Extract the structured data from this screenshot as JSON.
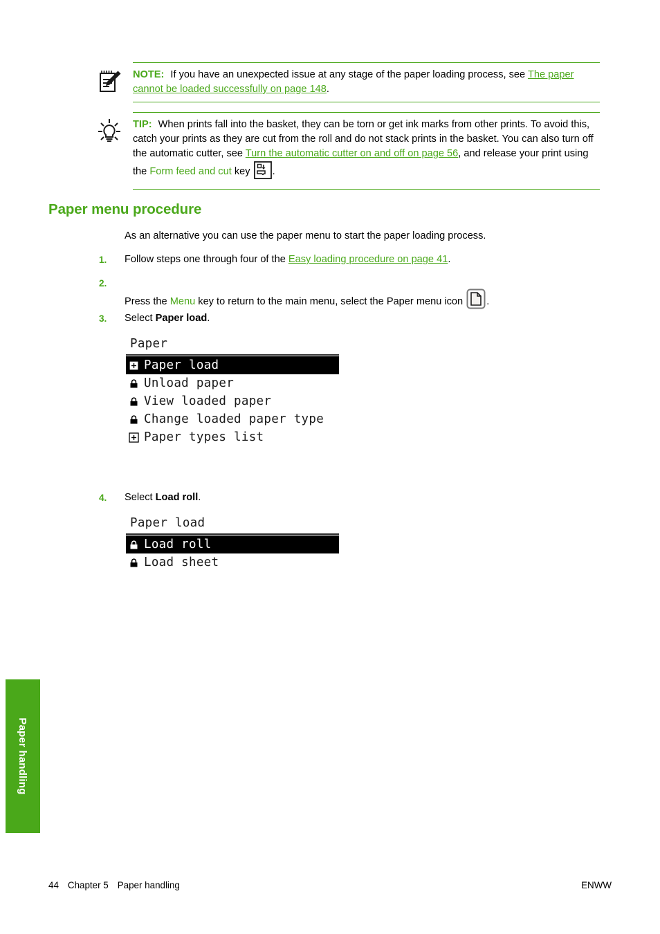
{
  "page": {
    "side_tab_label": "Paper handling",
    "accent_green": "#4aa81a",
    "footer": {
      "page_number": "44",
      "chapter": "Chapter 5",
      "chapter_title": "Paper handling",
      "right_label": "ENWW"
    }
  },
  "note": {
    "icon": "note-pencil-icon",
    "label": "NOTE:",
    "text_before": "If you have an unexpected issue at any stage of the paper loading process, see ",
    "link": "The paper cannot be loaded successfully on page 148",
    "text_after": "."
  },
  "tip": {
    "icon": "lightbulb-icon",
    "label": "TIP:",
    "text_1": "When prints fall into the basket, they can be torn or get ink marks from other prints. To avoid this, catch your prints as they are cut from the roll and do not stack prints in the basket. You can also turn off the automatic cutter, see ",
    "link_1": "Turn the automatic cutter on and off on page 56",
    "text_2": ", and release your print using the ",
    "key_name": "Form feed and cut",
    "text_3": " key",
    "key_icon": "form-feed-and-cut-key-icon",
    "text_4": "."
  },
  "section": {
    "heading": "Paper menu procedure",
    "intro": "As an alternative you can use the paper menu to start the paper loading process."
  },
  "steps": [
    {
      "number": "1.",
      "text_before": "Follow steps one through four of the ",
      "link": "Easy loading procedure on page 41",
      "text_after": "."
    },
    {
      "number": "2.",
      "text_before": "Press the ",
      "key_name": "Menu",
      "text_middle": " key to return to the main menu, select the Paper menu icon ",
      "icon": "paper-menu-page-icon",
      "text_after": "."
    },
    {
      "number": "3.",
      "text_before": "Select ",
      "bold": "Paper load",
      "text_after": "."
    },
    {
      "number": "4.",
      "text_before": "Select ",
      "bold": "Load roll",
      "text_after": "."
    }
  ],
  "lcd_paper_menu": {
    "title": "Paper",
    "rows": [
      {
        "icon": "submenu-plus-icon",
        "label": "Paper load",
        "selected": true
      },
      {
        "icon": "padlock-icon",
        "label": "Unload paper",
        "selected": false
      },
      {
        "icon": "padlock-icon",
        "label": "View loaded paper",
        "selected": false
      },
      {
        "icon": "padlock-icon",
        "label": "Change loaded paper type",
        "selected": false
      },
      {
        "icon": "submenu-plus-icon",
        "label": "Paper types list",
        "selected": false
      }
    ]
  },
  "lcd_paper_load_menu": {
    "title": "Paper load",
    "rows": [
      {
        "icon": "padlock-icon",
        "label": "Load roll",
        "selected": true
      },
      {
        "icon": "padlock-icon",
        "label": "Load sheet",
        "selected": false
      }
    ]
  }
}
